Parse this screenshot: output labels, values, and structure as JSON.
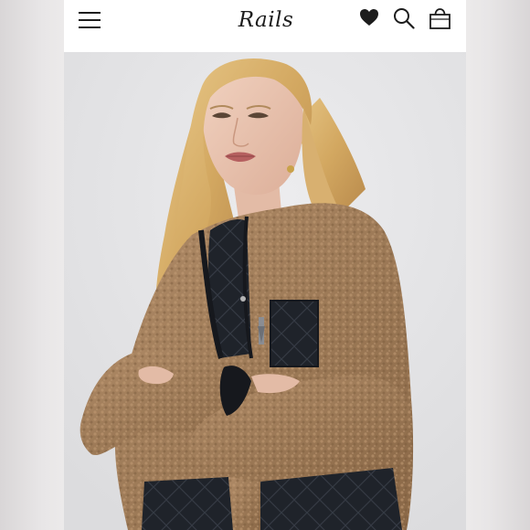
{
  "app": {
    "brand": "Rails"
  },
  "header": {
    "icons": [
      "menu-icon",
      "heart-icon",
      "search-icon",
      "bag-icon"
    ]
  },
  "colors": {
    "background": "#ffffff",
    "ink": "#1d1d1d",
    "hero_bg": "#e6e6e8",
    "sherpa": "#a17e5c",
    "quilt": "#1e2127",
    "hair": "#d9b36e"
  }
}
